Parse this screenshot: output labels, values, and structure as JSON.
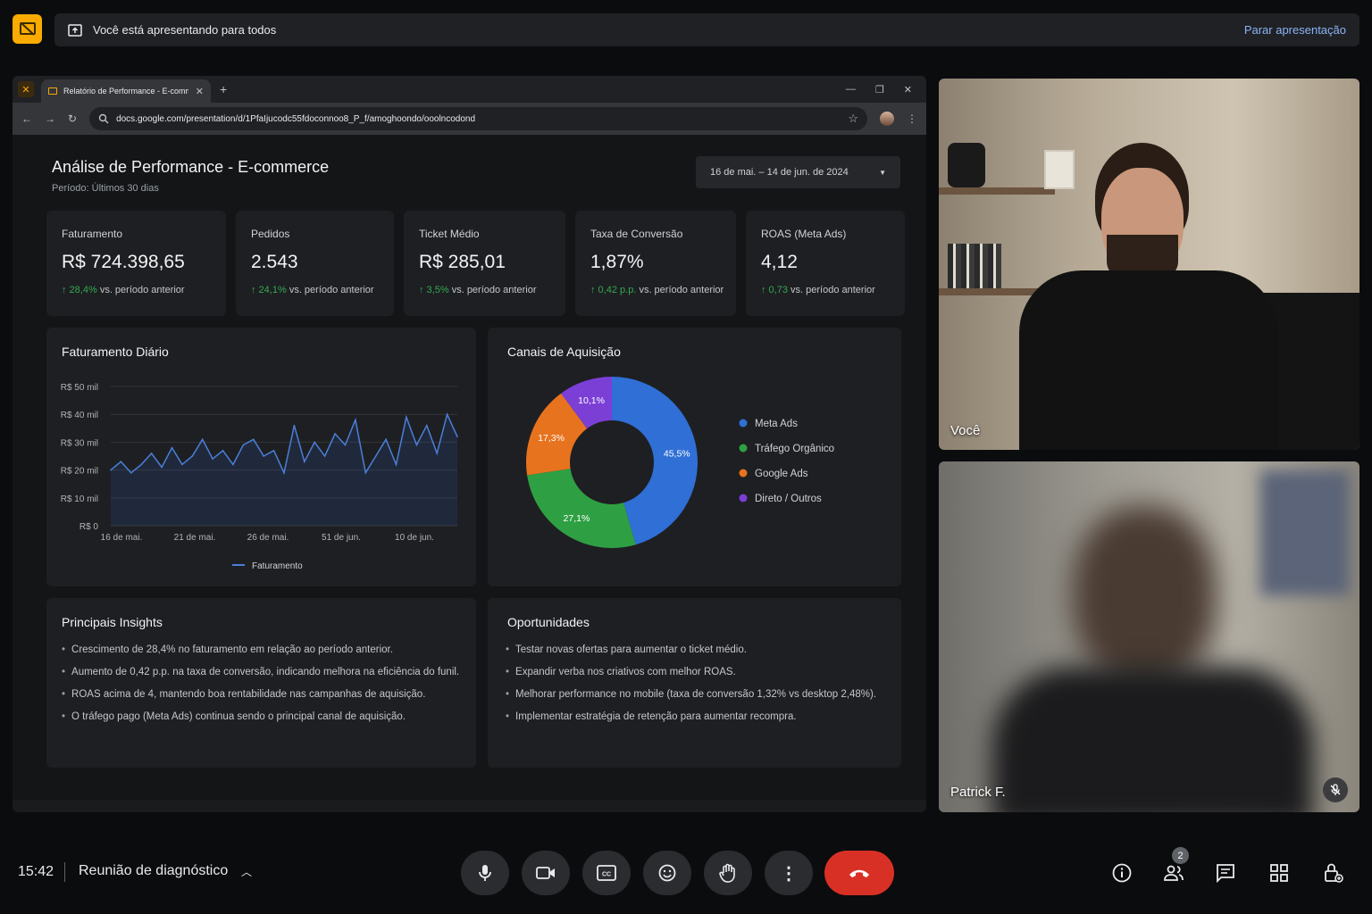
{
  "banner": {
    "presenting_text": "Você está apresentando para todos",
    "stop_label": "Parar apresentação"
  },
  "browser": {
    "tab_title": "Relatório de Performance - E-commerce",
    "url": "docs.google.com/presentation/d/1PfaIjucodc55fdoconnoo8_P_f/amoghoondo/ooolncodond"
  },
  "slide": {
    "title": "Análise de Performance - E-commerce",
    "subtitle": "Período: Últimos 30 dias",
    "date_range": "16 de mai. – 14 de jun. de 2024",
    "kpis": [
      {
        "label": "Faturamento",
        "value": "R$ 724.398,65",
        "change": "↑ 28,4%",
        "suffix": "vs. período anterior"
      },
      {
        "label": "Pedidos",
        "value": "2.543",
        "change": "↑ 24,1%",
        "suffix": "vs. período anterior"
      },
      {
        "label": "Ticket Médio",
        "value": "R$ 285,01",
        "change": "↑ 3,5%",
        "suffix": "vs. período anterior"
      },
      {
        "label": "Taxa de Conversão",
        "value": "1,87%",
        "change": "↑ 0,42 p.p.",
        "suffix": "vs. período anterior"
      },
      {
        "label": "ROAS (Meta Ads)",
        "value": "4,12",
        "change": "↑ 0,73",
        "suffix": "vs. período anterior"
      }
    ],
    "daily_title": "Faturamento Diário",
    "channels_title": "Canais de Aquisição",
    "insights_title": "Principais Insights",
    "insights": [
      "Crescimento de 28,4% no faturamento em relação ao período anterior.",
      "Aumento de 0,42 p.p. na taxa de conversão, indicando melhora na eficiência do funil.",
      "ROAS acima de 4, mantendo boa rentabilidade nas campanhas de aquisição.",
      "O tráfego pago (Meta Ads) continua sendo o principal canal de aquisição."
    ],
    "opps_title": "Oportunidades",
    "opportunities": [
      "Testar novas ofertas para aumentar o ticket médio.",
      "Expandir verba nos criativos com melhor ROAS.",
      "Melhorar performance no mobile (taxa de conversão 1,32% vs desktop 2,48%).",
      "Implementar estratégia de retenção para aumentar recompra."
    ]
  },
  "chart_data": [
    {
      "type": "line",
      "title": "Faturamento Diário",
      "ylim": [
        0,
        50
      ],
      "yticks": [
        "R$ 0",
        "R$ 10 mil",
        "R$ 20 mil",
        "R$ 30 mil",
        "R$ 40 mil",
        "R$ 50 mil"
      ],
      "xticks": [
        "16 de mai.",
        "21 de mai.",
        "26 de mai.",
        "51 de jun.",
        "10 de jun."
      ],
      "x": [
        "16/05",
        "17/05",
        "18/05",
        "19/05",
        "20/05",
        "21/05",
        "22/05",
        "23/05",
        "24/05",
        "25/05",
        "26/05",
        "27/05",
        "28/05",
        "29/05",
        "30/05",
        "31/05",
        "01/06",
        "02/06",
        "03/06",
        "04/06",
        "05/06",
        "06/06",
        "07/06",
        "08/06",
        "09/06",
        "10/06",
        "11/06",
        "12/06",
        "13/06",
        "14/06"
      ],
      "series": [
        {
          "name": "Faturamento",
          "color": "#4a7fd9",
          "values": [
            20,
            23,
            19,
            22,
            26,
            21,
            28,
            22,
            25,
            31,
            24,
            27,
            22,
            29,
            31,
            25,
            27,
            19,
            36,
            23,
            30,
            25,
            33,
            29,
            38,
            19,
            25,
            31,
            22,
            39,
            29,
            36,
            26,
            40,
            32
          ]
        }
      ],
      "legend": "bottom"
    },
    {
      "type": "pie",
      "title": "Canais de Aquisição",
      "categories": [
        "Meta Ads",
        "Tráfego Orgânico",
        "Google Ads",
        "Direto / Outros"
      ],
      "values": [
        45.5,
        27.1,
        17.3,
        10.1
      ],
      "labels": [
        "45,5%",
        "27,1%",
        "17,3%",
        "10,1%"
      ],
      "colors": [
        "#2f6fd6",
        "#2ea043",
        "#e8731f",
        "#7b3fd6"
      ],
      "legend": "right"
    }
  ],
  "participants": [
    {
      "name": "Você"
    },
    {
      "name": "Patrick F."
    }
  ],
  "meeting": {
    "time": "15:42",
    "name": "Reunião de diagnóstico",
    "people_count": "2"
  }
}
